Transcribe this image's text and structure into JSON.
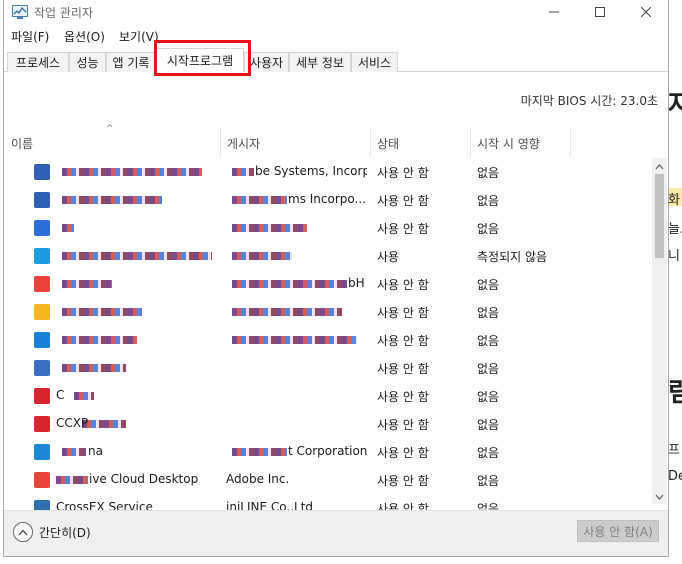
{
  "window": {
    "title": "작업 관리자",
    "minimize_icon": "minimize-icon",
    "maximize_icon": "maximize-icon",
    "close_icon": "close-icon"
  },
  "menu": [
    "파일(F)",
    "옵션(O)",
    "보기(V)"
  ],
  "tabs": [
    "프로세스",
    "성능",
    "앱 기록",
    "시작프로그램",
    "사용자",
    "세부 정보",
    "서비스"
  ],
  "active_tab": "시작프로그램",
  "bios_time": "마지막 BIOS 시간:  23.0초",
  "columns": [
    "이름",
    "게시자",
    "상태",
    "시작 시 영향"
  ],
  "rows": [
    {
      "name": "",
      "publisher": "be Systems, Incorp...",
      "status": "사용 안 함",
      "impact": "없음",
      "icon_color": "#2f5fb3"
    },
    {
      "name": "",
      "publisher": "ms Incorpo...",
      "status": "사용 안 함",
      "impact": "없음",
      "icon_color": "#2f5fb3"
    },
    {
      "name": "",
      "publisher": "",
      "status": "사용 안 함",
      "impact": "없음",
      "icon_color": "#2a6fd6"
    },
    {
      "name": "",
      "publisher": "",
      "status": "사용",
      "impact": "측정되지 않음",
      "icon_color": "#1e9be0"
    },
    {
      "name": "",
      "publisher": "bH",
      "status": "사용 안 함",
      "impact": "없음",
      "icon_color": "#e8423a"
    },
    {
      "name": "",
      "publisher": "",
      "status": "사용 안 함",
      "impact": "없음",
      "icon_color": "#f3b81d"
    },
    {
      "name": "",
      "publisher": "",
      "status": "사용 안 함",
      "impact": "없음",
      "icon_color": "#1a7fd6"
    },
    {
      "name": "",
      "publisher": "",
      "status": "사용 안 함",
      "impact": "없음",
      "icon_color": "#3a6fbf"
    },
    {
      "name": "C",
      "publisher": "",
      "status": "사용 안 함",
      "impact": "없음",
      "icon_color": "#d9232d"
    },
    {
      "name": "CCXP",
      "publisher": "",
      "status": "사용 안 함",
      "impact": "없음",
      "icon_color": "#d9232d"
    },
    {
      "name": "na",
      "publisher": "t Corporation",
      "status": "사용 안 함",
      "impact": "없음",
      "icon_color": "#1e88d8"
    },
    {
      "name": "ive Cloud Desktop",
      "publisher": "Adobe Inc.",
      "status": "사용 안 함",
      "impact": "없음",
      "icon_color": "#e8423a"
    },
    {
      "name": "CrossEX Service",
      "publisher": "iniLINE Co.,Ltd",
      "status": "사용 안 함",
      "impact": "없음",
      "icon_color": "#2f6fb0"
    }
  ],
  "footer": {
    "fewer_details": "간단히(D)",
    "disable_button": "사용 안 함(A)"
  },
  "background_window": {
    "glyphs": [
      "자",
      "화",
      "늘도",
      "니",
      "림",
      "프",
      "Del"
    ]
  }
}
